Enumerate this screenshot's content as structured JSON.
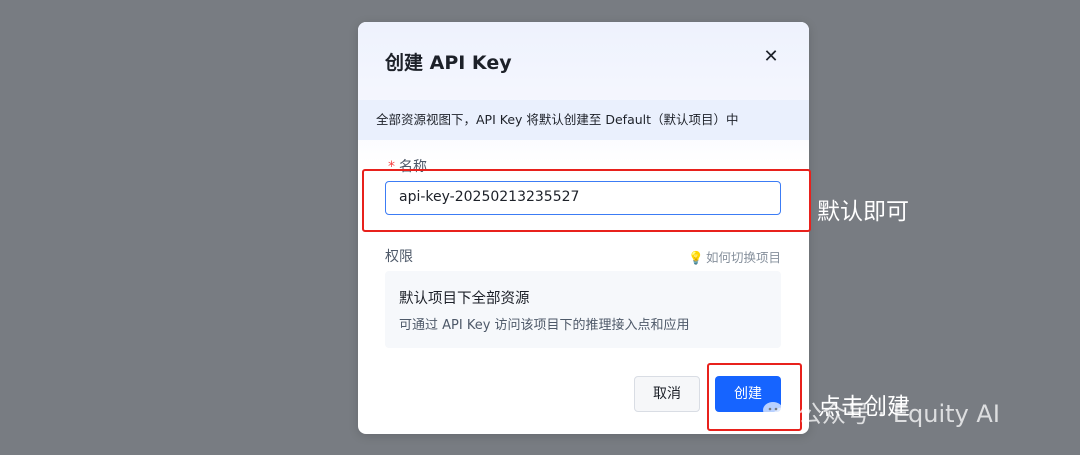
{
  "dialog": {
    "title": "创建 API Key",
    "close_icon": "close-icon",
    "notice": "全部资源视图下，API Key 将默认创建至 Default（默认项目）中",
    "name_field": {
      "required_mark": "*",
      "label": "名称",
      "value": "api-key-20250213235527"
    },
    "permissions": {
      "label": "权限",
      "help_link": "如何切换项目",
      "help_icon": "lightbulb-icon",
      "scope_title": "默认项目下全部资源",
      "scope_desc": "可通过 API Key 访问该项目下的推理接入点和应用"
    },
    "buttons": {
      "cancel": "取消",
      "create": "创建"
    },
    "colors": {
      "primary": "#1664ff",
      "required": "#f53f3f",
      "highlight": "#e8211c"
    }
  },
  "annotations": {
    "name_hint": "默认即可",
    "create_hint": "点击创建"
  },
  "watermark": {
    "text": "公众号 · Equity AI",
    "icon": "wechat-icon"
  }
}
